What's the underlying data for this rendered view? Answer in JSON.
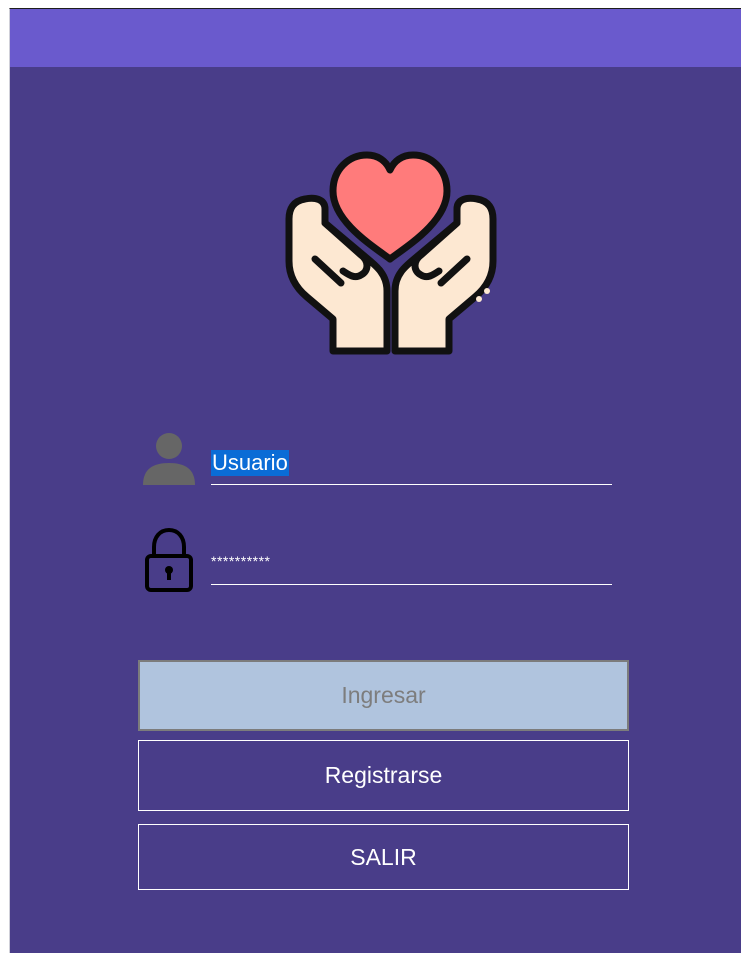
{
  "colors": {
    "window_background": "#493d89",
    "title_bar": "#6a5acd",
    "primary_button_bg": "#b0c4de",
    "selection_highlight": "#0a6cd6"
  },
  "logo": {
    "icon": "hands-holding-heart-icon"
  },
  "login": {
    "username": {
      "icon": "user-icon",
      "value": "Usuario"
    },
    "password": {
      "icon": "lock-icon",
      "value": "**********"
    }
  },
  "buttons": {
    "ingresar": "Ingresar",
    "registrarse": "Registrarse",
    "salir": "SALIR"
  }
}
